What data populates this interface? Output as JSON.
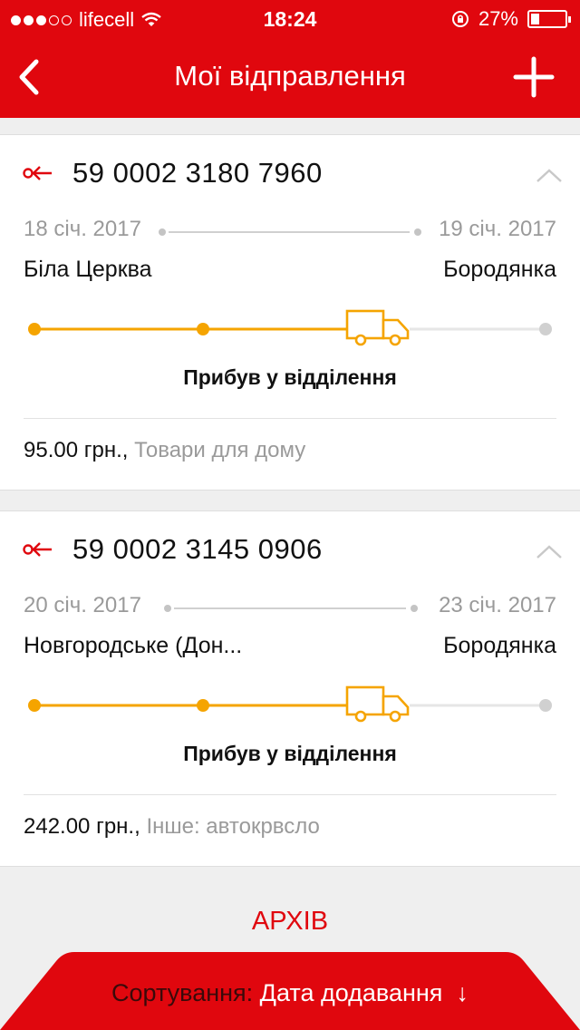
{
  "status_bar": {
    "carrier": "lifecell",
    "time": "18:24",
    "battery": "27%",
    "battery_level": 0.27
  },
  "header": {
    "title": "Мої відправлення",
    "back_icon": "chevron-left-icon",
    "add_icon": "plus-icon"
  },
  "shipments": [
    {
      "tracking": "59 0002 3180 7960",
      "date_from": "18 січ. 2017",
      "date_to": "19 січ. 2017",
      "city_from": "Біла Церква",
      "city_to": "Бородянка",
      "status": "Прибув у відділення",
      "price": "95.00 грн.,",
      "description": "Товари для дому",
      "progress_step": 3,
      "progress_steps_total": 4
    },
    {
      "tracking": "59 0002 3145 0906",
      "date_from": "20 січ. 2017",
      "date_to": "23 січ. 2017",
      "city_from": "Новгородське (Дон...",
      "city_to": "Бородянка",
      "status": "Прибув у відділення",
      "price": "242.00 грн.,",
      "description": "Інше: автокрвсло",
      "progress_step": 3,
      "progress_steps_total": 4
    }
  ],
  "archive": {
    "label": "АРХІВ"
  },
  "sort": {
    "label": "Сортування:",
    "value": "Дата додавання",
    "icon": "arrow-down-icon"
  },
  "colors": {
    "brand_red": "#e0070e",
    "progress_orange": "#f5a400",
    "muted_gray": "#9a9a9a"
  }
}
